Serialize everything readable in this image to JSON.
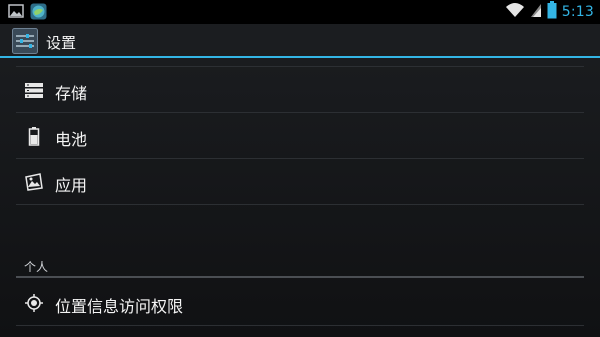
{
  "status_bar": {
    "time": "5:13",
    "left_icons": [
      "gallery-icon",
      "globe-app-icon"
    ],
    "right_icons": [
      "wifi-icon",
      "signal-icon",
      "battery-icon"
    ],
    "accent": "#33b5e5"
  },
  "action_bar": {
    "title": "设置",
    "icon": "settings-sliders-icon"
  },
  "list": {
    "items": [
      {
        "label": "存储",
        "icon": "storage-icon"
      },
      {
        "label": "电池",
        "icon": "battery-icon"
      },
      {
        "label": "应用",
        "icon": "apps-icon"
      }
    ],
    "section_personal": "个人",
    "personal_items": [
      {
        "label": "位置信息访问权限",
        "icon": "location-icon"
      }
    ]
  }
}
